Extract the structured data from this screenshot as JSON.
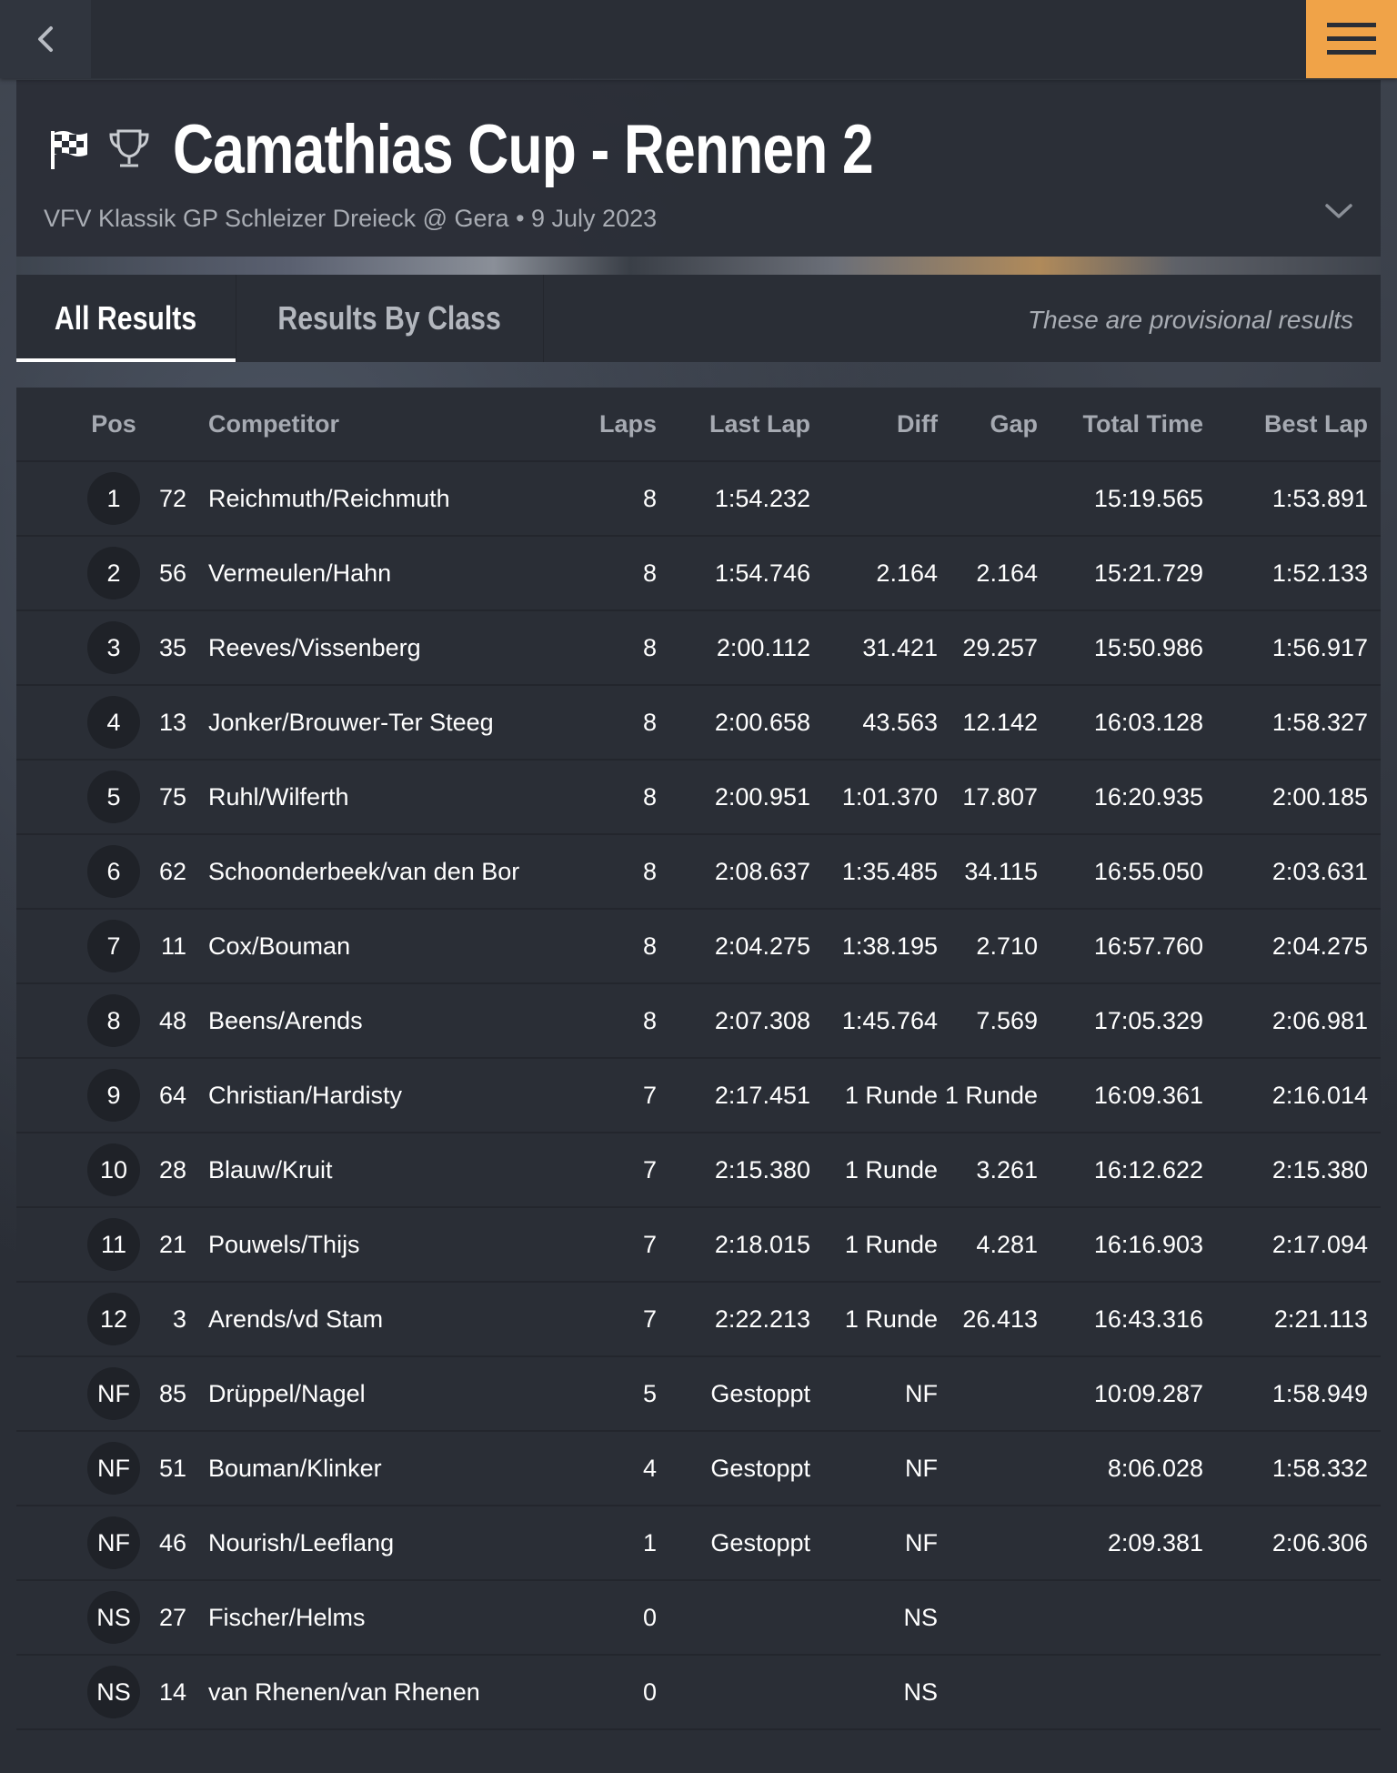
{
  "header": {
    "title": "Camathias Cup - Rennen 2",
    "subtitle": "VFV Klassik GP Schleizer Dreieck @ Gera • 9 July 2023"
  },
  "tabs": {
    "all_results": "All Results",
    "results_by_class": "Results By Class",
    "provisional_note": "These are provisional results"
  },
  "table": {
    "columns": {
      "pos": "Pos",
      "competitor": "Competitor",
      "laps": "Laps",
      "last_lap": "Last Lap",
      "diff": "Diff",
      "gap": "Gap",
      "total_time": "Total Time",
      "best_lap": "Best Lap"
    },
    "rows": [
      {
        "pos": "1",
        "num": "72",
        "competitor": "Reichmuth/Reichmuth",
        "laps": "8",
        "last_lap": "1:54.232",
        "diff": "",
        "gap": "",
        "total": "15:19.565",
        "best": "1:53.891"
      },
      {
        "pos": "2",
        "num": "56",
        "competitor": "Vermeulen/Hahn",
        "laps": "8",
        "last_lap": "1:54.746",
        "diff": "2.164",
        "gap": "2.164",
        "total": "15:21.729",
        "best": "1:52.133"
      },
      {
        "pos": "3",
        "num": "35",
        "competitor": "Reeves/Vissenberg",
        "laps": "8",
        "last_lap": "2:00.112",
        "diff": "31.421",
        "gap": "29.257",
        "total": "15:50.986",
        "best": "1:56.917"
      },
      {
        "pos": "4",
        "num": "13",
        "competitor": "Jonker/Brouwer-Ter Steeg",
        "laps": "8",
        "last_lap": "2:00.658",
        "diff": "43.563",
        "gap": "12.142",
        "total": "16:03.128",
        "best": "1:58.327"
      },
      {
        "pos": "5",
        "num": "75",
        "competitor": "Ruhl/Wilferth",
        "laps": "8",
        "last_lap": "2:00.951",
        "diff": "1:01.370",
        "gap": "17.807",
        "total": "16:20.935",
        "best": "2:00.185"
      },
      {
        "pos": "6",
        "num": "62",
        "competitor": "Schoonderbeek/van den Bor",
        "laps": "8",
        "last_lap": "2:08.637",
        "diff": "1:35.485",
        "gap": "34.115",
        "total": "16:55.050",
        "best": "2:03.631"
      },
      {
        "pos": "7",
        "num": "11",
        "competitor": "Cox/Bouman",
        "laps": "8",
        "last_lap": "2:04.275",
        "diff": "1:38.195",
        "gap": "2.710",
        "total": "16:57.760",
        "best": "2:04.275"
      },
      {
        "pos": "8",
        "num": "48",
        "competitor": "Beens/Arends",
        "laps": "8",
        "last_lap": "2:07.308",
        "diff": "1:45.764",
        "gap": "7.569",
        "total": "17:05.329",
        "best": "2:06.981"
      },
      {
        "pos": "9",
        "num": "64",
        "competitor": "Christian/Hardisty",
        "laps": "7",
        "last_lap": "2:17.451",
        "diff": "1 Runde",
        "gap": "1 Runde",
        "total": "16:09.361",
        "best": "2:16.014"
      },
      {
        "pos": "10",
        "num": "28",
        "competitor": "Blauw/Kruit",
        "laps": "7",
        "last_lap": "2:15.380",
        "diff": "1 Runde",
        "gap": "3.261",
        "total": "16:12.622",
        "best": "2:15.380"
      },
      {
        "pos": "11",
        "num": "21",
        "competitor": "Pouwels/Thijs",
        "laps": "7",
        "last_lap": "2:18.015",
        "diff": "1 Runde",
        "gap": "4.281",
        "total": "16:16.903",
        "best": "2:17.094"
      },
      {
        "pos": "12",
        "num": "3",
        "competitor": "Arends/vd Stam",
        "laps": "7",
        "last_lap": "2:22.213",
        "diff": "1 Runde",
        "gap": "26.413",
        "total": "16:43.316",
        "best": "2:21.113"
      },
      {
        "pos": "NF",
        "num": "85",
        "competitor": "Drüppel/Nagel",
        "laps": "5",
        "last_lap": "Gestoppt",
        "diff": "NF",
        "gap": "",
        "total": "10:09.287",
        "best": "1:58.949"
      },
      {
        "pos": "NF",
        "num": "51",
        "competitor": "Bouman/Klinker",
        "laps": "4",
        "last_lap": "Gestoppt",
        "diff": "NF",
        "gap": "",
        "total": "8:06.028",
        "best": "1:58.332"
      },
      {
        "pos": "NF",
        "num": "46",
        "competitor": "Nourish/Leeflang",
        "laps": "1",
        "last_lap": "Gestoppt",
        "diff": "NF",
        "gap": "",
        "total": "2:09.381",
        "best": "2:06.306"
      },
      {
        "pos": "NS",
        "num": "27",
        "competitor": "Fischer/Helms",
        "laps": "0",
        "last_lap": "",
        "diff": "NS",
        "gap": "",
        "total": "",
        "best": ""
      },
      {
        "pos": "NS",
        "num": "14",
        "competitor": "van Rhenen/van Rhenen",
        "laps": "0",
        "last_lap": "",
        "diff": "NS",
        "gap": "",
        "total": "",
        "best": ""
      }
    ]
  },
  "icons": {
    "back": "chevron-left-icon",
    "menu": "hamburger-menu-icon",
    "flag": "checkered-flag-icon",
    "trophy": "trophy-icon",
    "expand": "chevron-down-icon"
  },
  "colors": {
    "accent": "#f0a348",
    "background": "#2a2e36",
    "badge": "#1f2228",
    "muted_text": "#a9adb4"
  }
}
